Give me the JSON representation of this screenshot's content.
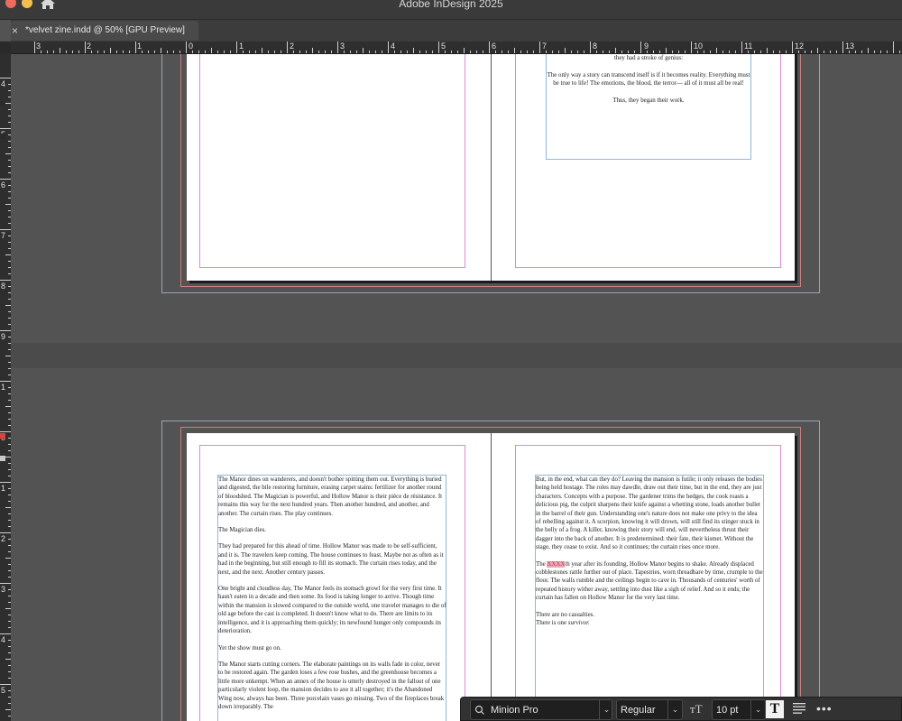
{
  "app": {
    "title": "Adobe InDesign 2025"
  },
  "document_tab": {
    "close_glyph": "×",
    "title": "*velvet zine.indd @ 50% [GPU Preview]"
  },
  "ruler_h": [
    "3",
    "2",
    "1",
    "0",
    "1",
    "2",
    "3",
    "4",
    "5",
    "6",
    "7",
    "8",
    "9",
    "10",
    "11",
    "12",
    "13"
  ],
  "ruler_v": [
    "4",
    "5",
    "6",
    "7",
    "8",
    "9",
    "1",
    "0",
    "1",
    "2",
    "3",
    "4",
    "5"
  ],
  "spread1": {
    "right_story": [
      "indeed. The Magician hemmed and hawed over several moons, until, one night, they had a stroke of genius:",
      "The only way a story can transcend itself is if it becomes reality. Every­thing must be true to life! The emotions, the blood, the terror— all of it must all be real!",
      "Thus, they began their work."
    ]
  },
  "spread2": {
    "left_story": [
      "The Manor dines on wanderers, and doesn't bother spitting them out. Everything is buried and digested, the bile restoring furniture, erasing carpet stains: fertilizer for another round of bloodshed. The Magician is powerful, and Hollow Manor is their pièce de résistance. It remains this way for the next hundred years. Then another hundred, and another, and another. The curtain rises. The play contin­ues.",
      "The Magician dies.",
      "They had prepared for this ahead of time. Hollow Manor was made to be self-sufficient, and it is. The travelers keep coming. The house continues to feast. Maybe not as often as it had in the beginning, but still enough to fill its stomach. The curtain rises today, and the next, and the next. Another century passes.",
      "One bright and cloudless day, The Manor feels its stomach growl for the very first time. It hasn't eaten in a decade and then some. Its food is taking longer to arrive. Though time within the mansion is slowed compared to the outside world, one traveler manages to die of old age before the cast is completed. It doesn't know what to do. There are limits to its intelligence, and it is approaching them quickly; its newfound hunger only compounds its deterioration.",
      "Yet the show must go on.",
      "The Manor starts cutting corners. The elaborate paintings on its walls fade in color, never to be restored again. The garden loses a few rose bushes, and the greenhouse becomes a little more unkempt. When an annex of the house is utterly destroyed in the fallout of one particularly violent loop, the mansion de­cides to axe it all together; it's the Abandoned Wing now, always has been. Three porcelain vases go missing. Two of the fireplaces break down irreparably. The"
    ],
    "right_story": {
      "p1": "But, in the end, what can they do? Leaving the mansion is futile; it only releas­es the bodies being held hostage. The roles may dawdle, draw out their time, but in the end, they are just characters. Concepts with a purpose. The gardener trims the hedges, the cook roasts a delicious pig, the culprit sharpens their knife against a whetting stone, loads another bullet in the barrel of their gun. Under­standing one's nature does not make one privy to the idea of rebelling against it. A scorpion, knowing it will drown, will still find its stinger stuck in the belly of a frog. A killer, knowing their story will end, will nevertheless thrust their dagger into the back of another. It is predetermined: their fate, their kismet. Without the stage, they cease to exist. And so it continues; the curtain rises once more.",
      "p2_lead": "The ",
      "p2_highlight": "XXXX",
      "p2_rest": "th year after its founding, Hollow Manor begins to shake. Already displaced cobblestones rattle further out of place. Tapestries, worn threadbare by time, crumple to the floor. The walls rumble and the ceilings begin to cave in. Thousands of centuries' worth of repeated history wither away, settling into dust like a sigh of relief. And so it ends; the curtain has fallen on Hollow Manor for the very last time.",
      "p3_line1": "There are no casualties.",
      "p3_line2_lead": "There is one ",
      "p3_line2_em": "survivor."
    }
  },
  "properties_bar": {
    "font_family": "Minion Pro",
    "font_style": "Regular",
    "font_size": "10 pt",
    "size_icon_glyph": "ᴛT",
    "type_glyph": "T",
    "dropdown_glyph": "⌄",
    "more_glyph": "•••"
  },
  "colors": {
    "pasteboard": "#535353",
    "margin_guide": "#d58bd8",
    "frame_edge": "#8fb8d8",
    "highlight": "#e8a8b6"
  }
}
